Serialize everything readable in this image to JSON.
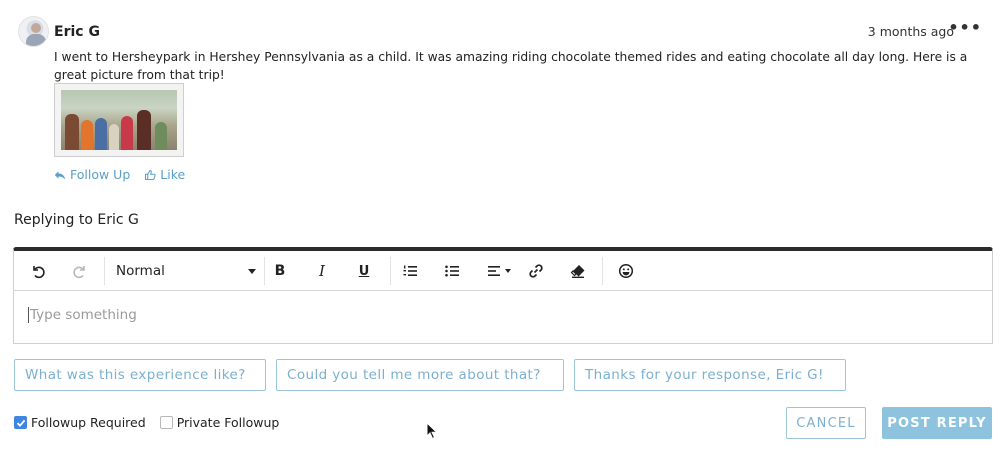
{
  "comment": {
    "author": "Eric G",
    "timestamp": "3 months ago",
    "more_label": "•••",
    "text": "I went to Hersheypark in Hershey Pennsylvania as a child. It was amazing riding chocolate themed rides and eating chocolate all day long. Here is a great picture from that trip!",
    "actions": {
      "follow_up": "Follow Up",
      "like": "Like"
    }
  },
  "reply": {
    "replying_to": "Replying to Eric G"
  },
  "editor": {
    "format_select": "Normal",
    "placeholder": "Type something",
    "toolbar_icons": [
      "undo-icon",
      "redo-icon",
      "bold-icon",
      "italic-icon",
      "underline-icon",
      "ordered-list-icon",
      "bullet-list-icon",
      "align-icon",
      "link-icon",
      "clear-format-icon",
      "emoji-icon"
    ]
  },
  "suggestions": [
    "What was this experience like?",
    "Could you tell me more about that?",
    "Thanks for your response, Eric G!"
  ],
  "options": {
    "followup_required": {
      "label": "Followup Required",
      "checked": true
    },
    "private_followup": {
      "label": "Private Followup",
      "checked": false
    }
  },
  "buttons": {
    "cancel": "CANCEL",
    "post_reply": "POST REPLY"
  },
  "colors": {
    "accent": "#5aa0c8",
    "button_fill": "#8ec3e0",
    "checkbox": "#3f86e0",
    "toolbar_border": "#2b2b2b"
  }
}
